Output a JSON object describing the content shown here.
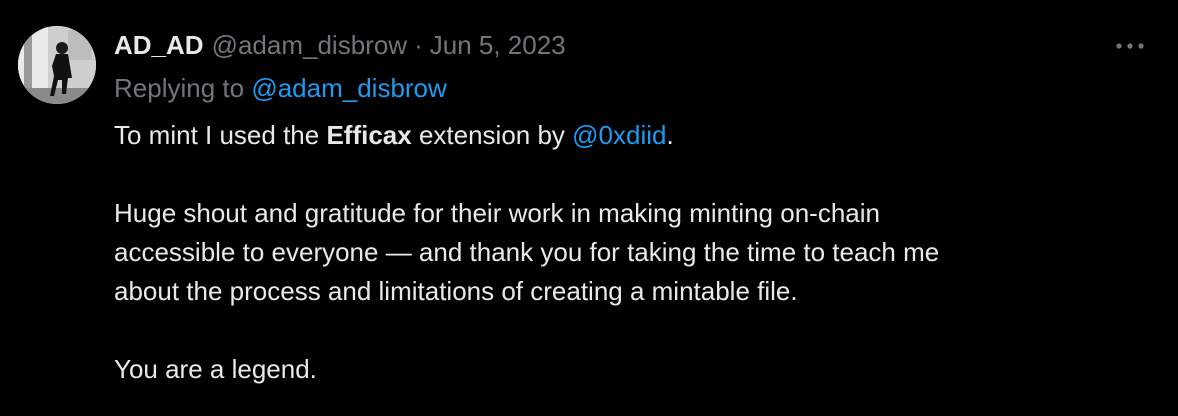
{
  "tweet": {
    "display_name": "AD_AD",
    "handle": "@adam_disbrow",
    "separator": "·",
    "date": "Jun 5, 2023",
    "replying_prefix": "Replying to",
    "replying_handle": "@adam_disbrow",
    "more_icon": "more-horizontal-icon",
    "avatar_icon": "avatar-photo",
    "line1": {
      "part1": "To mint I used the ",
      "bold": "Efficax",
      "part2": " extension by ",
      "mention": "@0xdiid",
      "part3": "."
    },
    "paragraph2": [
      "Huge shout and gratitude for their work in making minting on-chain",
      "accessible to everyone — and thank you for taking the time to teach me",
      "about the process and limitations of creating a mintable file."
    ],
    "closing": "You are a legend."
  },
  "colors": {
    "background": "#000000",
    "text": "#e7e9ea",
    "muted": "#71767b",
    "link": "#1d9bf0"
  }
}
